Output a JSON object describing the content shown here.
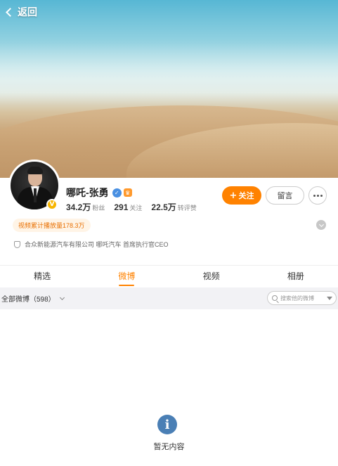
{
  "header": {
    "back_label": "返回"
  },
  "profile": {
    "name": "哪吒-张勇",
    "badges": [
      "verified-icon",
      "crown-icon"
    ],
    "avatar_badge": "V",
    "stats": [
      {
        "value": "34.2万",
        "label": "粉丝"
      },
      {
        "value": "291",
        "label": "关注"
      },
      {
        "value": "22.5万",
        "label": "转评赞"
      }
    ],
    "play_count": "视频累计播放量178.3万",
    "company": "合众新能源汽车有限公司 哪吒汽车 首席执行官CEO"
  },
  "actions": {
    "follow": "关注",
    "follow_icon": "+",
    "message": "留言"
  },
  "tabs": [
    {
      "label": "精选",
      "active": false
    },
    {
      "label": "微博",
      "active": true
    },
    {
      "label": "视频",
      "active": false
    },
    {
      "label": "相册",
      "active": false
    }
  ],
  "filter": {
    "label": "全部微博（598）",
    "search_placeholder": "搜索他的微博"
  },
  "empty": {
    "icon": "i",
    "text": "暂无内容"
  },
  "colors": {
    "accent": "#ff8200",
    "empty_icon": "#4a7fb5"
  }
}
